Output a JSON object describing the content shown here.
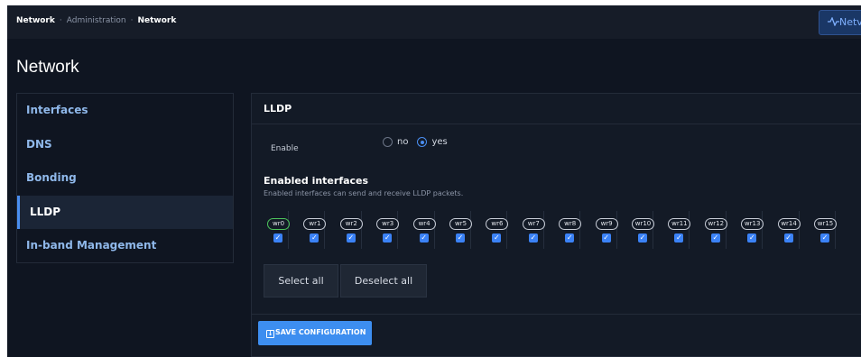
{
  "breadcrumb": {
    "items": [
      "Network",
      "Administration",
      "Network"
    ],
    "separator": "·"
  },
  "topbar": {
    "network_button_label": "Netv",
    "network_button_icon": "activity-icon"
  },
  "page": {
    "title": "Network"
  },
  "sidebar": {
    "items": [
      {
        "label": "Interfaces"
      },
      {
        "label": "DNS"
      },
      {
        "label": "Bonding"
      },
      {
        "label": "LLDP",
        "active": true
      },
      {
        "label": "In-band Management"
      }
    ]
  },
  "lldp": {
    "header": "LLDP",
    "enable": {
      "label": "Enable",
      "options": [
        "no",
        "yes"
      ],
      "selected": "yes"
    },
    "enabled_interfaces": {
      "title": "Enabled interfaces",
      "description": "Enabled interfaces can send and receive LLDP packets.",
      "interfaces": [
        {
          "name": "wr0",
          "checked": true,
          "highlight": true
        },
        {
          "name": "wr1",
          "checked": true
        },
        {
          "name": "wr2",
          "checked": true
        },
        {
          "name": "wr3",
          "checked": true
        },
        {
          "name": "wr4",
          "checked": true
        },
        {
          "name": "wr5",
          "checked": true
        },
        {
          "name": "wr6",
          "checked": true
        },
        {
          "name": "wr7",
          "checked": true
        },
        {
          "name": "wr8",
          "checked": true
        },
        {
          "name": "wr9",
          "checked": true
        },
        {
          "name": "wr10",
          "checked": true
        },
        {
          "name": "wr11",
          "checked": true
        },
        {
          "name": "wr12",
          "checked": true
        },
        {
          "name": "wr13",
          "checked": true
        },
        {
          "name": "wr14",
          "checked": true
        },
        {
          "name": "wr15",
          "checked": true
        }
      ]
    },
    "select_all_label": "Select all",
    "deselect_all_label": "Deselect all",
    "save_label": "SAVE CONFIGURATION"
  },
  "colors": {
    "accent": "#3d8ef0",
    "background": "#0f1521",
    "panel": "#131a26",
    "active_interface": "#4cc45b"
  }
}
